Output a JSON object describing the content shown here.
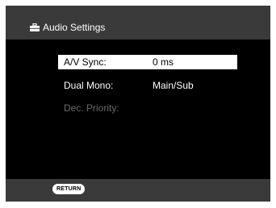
{
  "header": {
    "title": "Audio Settings",
    "icon": "toolbox-icon"
  },
  "menu": {
    "items": [
      {
        "label": "A/V Sync:",
        "value": "0 ms",
        "state": "selected"
      },
      {
        "label": "Dual Mono:",
        "value": "Main/Sub",
        "state": "normal"
      },
      {
        "label": "Dec. Priority:",
        "value": "",
        "state": "disabled"
      }
    ]
  },
  "footer": {
    "return_label": "RETURN"
  },
  "colors": {
    "background": "#000000",
    "bar": "#3a3a3a",
    "highlight": "#ffffff",
    "disabled_text": "#6a6a6a"
  }
}
